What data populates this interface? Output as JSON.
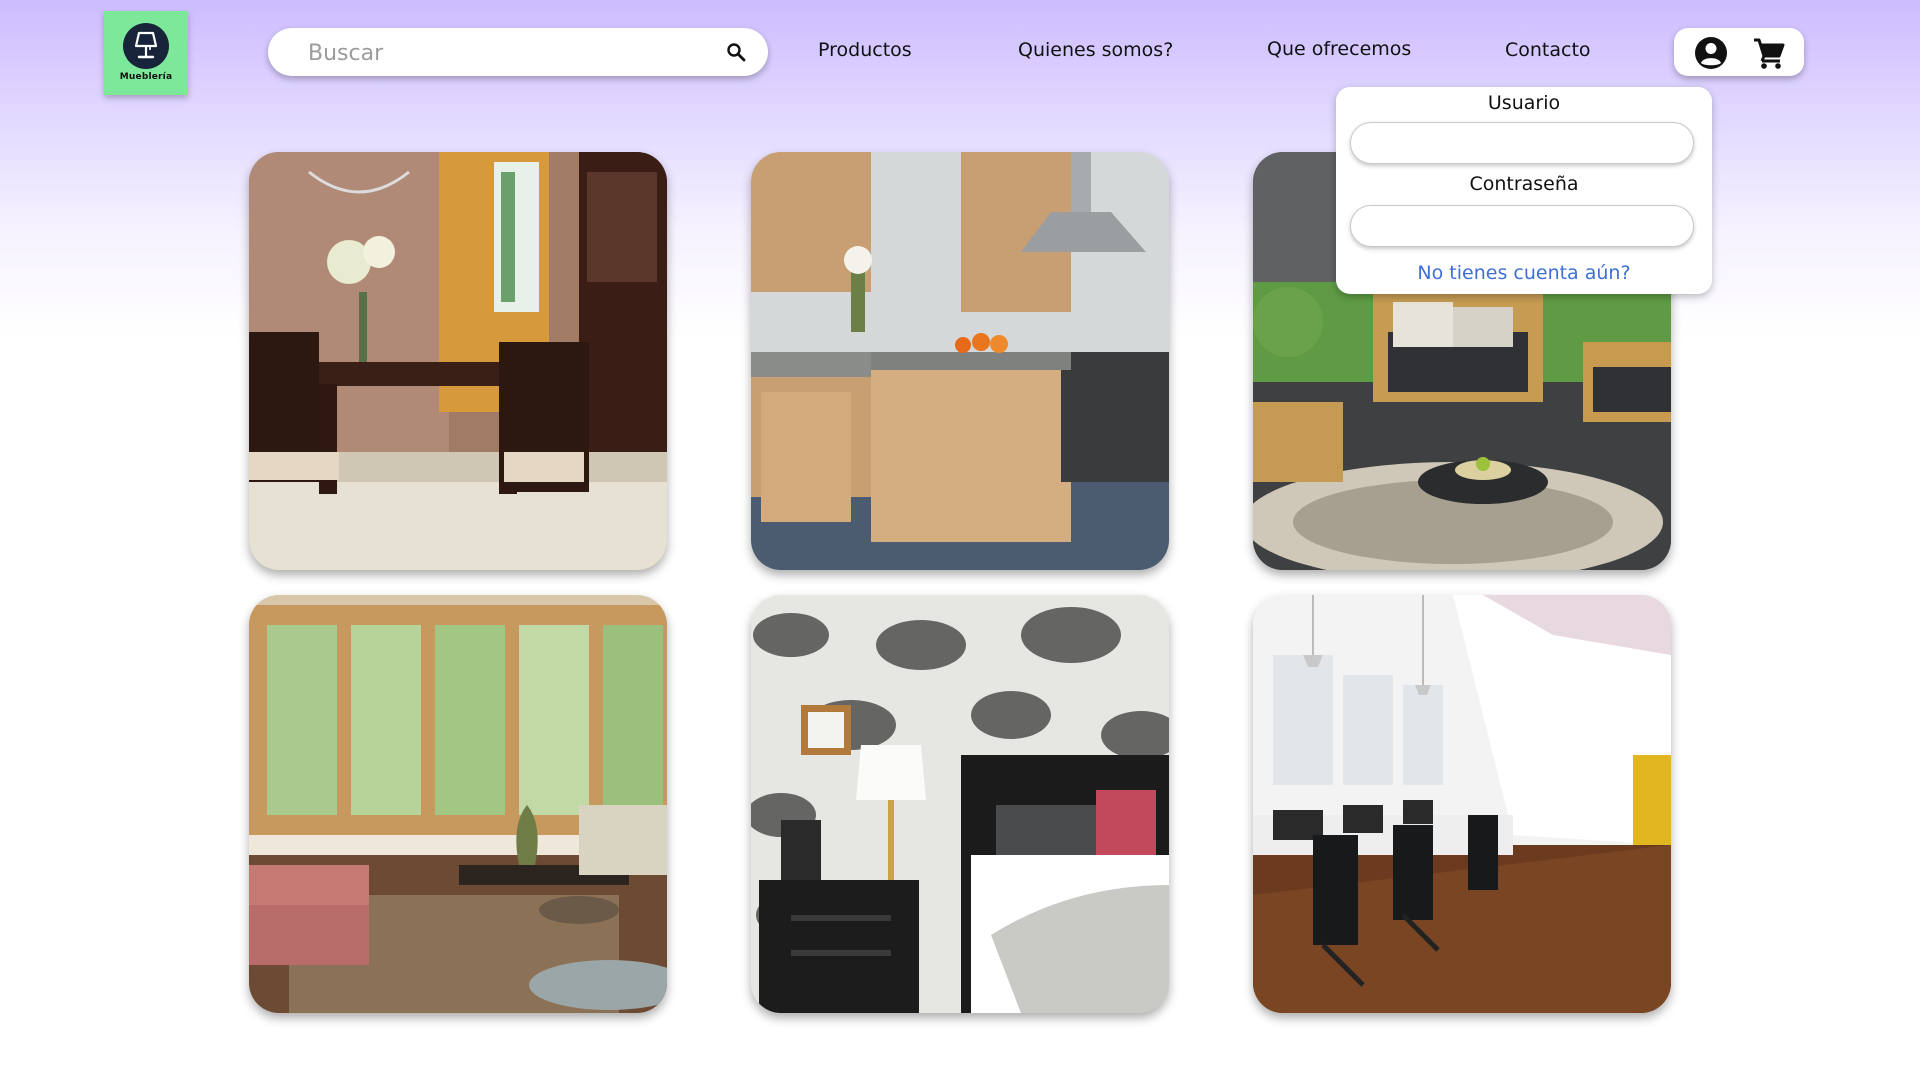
{
  "brand": {
    "logo_text": "Mueblería",
    "logo_color": "#7ee89a"
  },
  "search": {
    "placeholder": "Buscar",
    "icon": "search-icon"
  },
  "nav": {
    "items": [
      {
        "label": "Productos"
      },
      {
        "label": "Quienes somos?"
      },
      {
        "label": "Que ofrecemos"
      },
      {
        "label": "Contacto"
      }
    ]
  },
  "header_actions": {
    "account_icon": "account-circle-icon",
    "cart_icon": "shopping-cart-icon"
  },
  "login": {
    "user_label": "Usuario",
    "password_label": "Contraseña",
    "signup_link": "No tienes cuenta aún?",
    "link_color": "#3f6fd6"
  },
  "gallery": {
    "tiles": [
      {
        "subject": "dining-room"
      },
      {
        "subject": "kitchen"
      },
      {
        "subject": "patio"
      },
      {
        "subject": "living-room"
      },
      {
        "subject": "bedroom"
      },
      {
        "subject": "office"
      }
    ]
  },
  "colors": {
    "header_gradient_top": "#cdbcff",
    "logo_badge": "#17243a"
  }
}
